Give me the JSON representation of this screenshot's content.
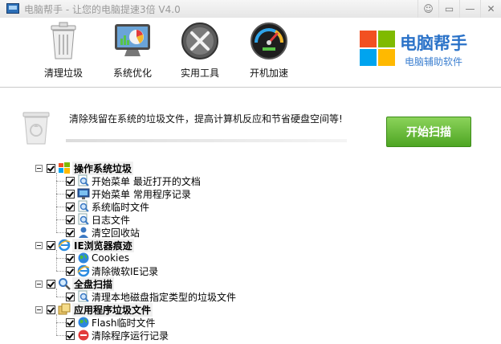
{
  "window": {
    "title": "电脑帮手 - 让您的电脑提速3倍 V4.0",
    "buttons": [
      "☺",
      "▭",
      "—",
      "✕"
    ]
  },
  "toolbar": {
    "items": [
      {
        "label": "清理垃圾",
        "icon": "trash-icon"
      },
      {
        "label": "系统优化",
        "icon": "monitor-chart-icon"
      },
      {
        "label": "实用工具",
        "icon": "tools-icon"
      },
      {
        "label": "开机加速",
        "icon": "speedometer-icon"
      }
    ]
  },
  "brand": {
    "name": "电脑帮手",
    "subtitle": "电脑辅助软件",
    "colors": [
      "#f25022",
      "#7fba00",
      "#00a4ef",
      "#ffb900"
    ]
  },
  "main": {
    "description": "清除残留在系统的垃圾文件，提高计算机反应和节省硬盘空间等!",
    "scan_button": "开始扫描"
  },
  "tree": [
    {
      "label": "操作系统垃圾",
      "icon": "windows-icon",
      "children": [
        {
          "label": "开始菜单 最近打开的文档",
          "icon": "search-doc-icon"
        },
        {
          "label": "开始菜单 常用程序记录",
          "icon": "monitor-icon"
        },
        {
          "label": "系统临时文件",
          "icon": "search-doc-icon"
        },
        {
          "label": "日志文件",
          "icon": "search-doc-icon"
        },
        {
          "label": "清空回收站",
          "icon": "user-icon"
        }
      ]
    },
    {
      "label": "IE浏览器痕迹",
      "icon": "ie-icon",
      "children": [
        {
          "label": "Cookies",
          "icon": "globe-icon"
        },
        {
          "label": "清除微软IE记录",
          "icon": "ie-icon"
        }
      ]
    },
    {
      "label": "全盘扫描",
      "icon": "search-icon",
      "children": [
        {
          "label": "清理本地磁盘指定类型的垃圾文件",
          "icon": "search-doc-icon"
        }
      ]
    },
    {
      "label": "应用程序垃圾文件",
      "icon": "apps-icon",
      "children": [
        {
          "label": "Flash临时文件",
          "icon": "globe-icon"
        },
        {
          "label": "清除程序运行记录",
          "icon": "stop-icon"
        }
      ]
    }
  ]
}
